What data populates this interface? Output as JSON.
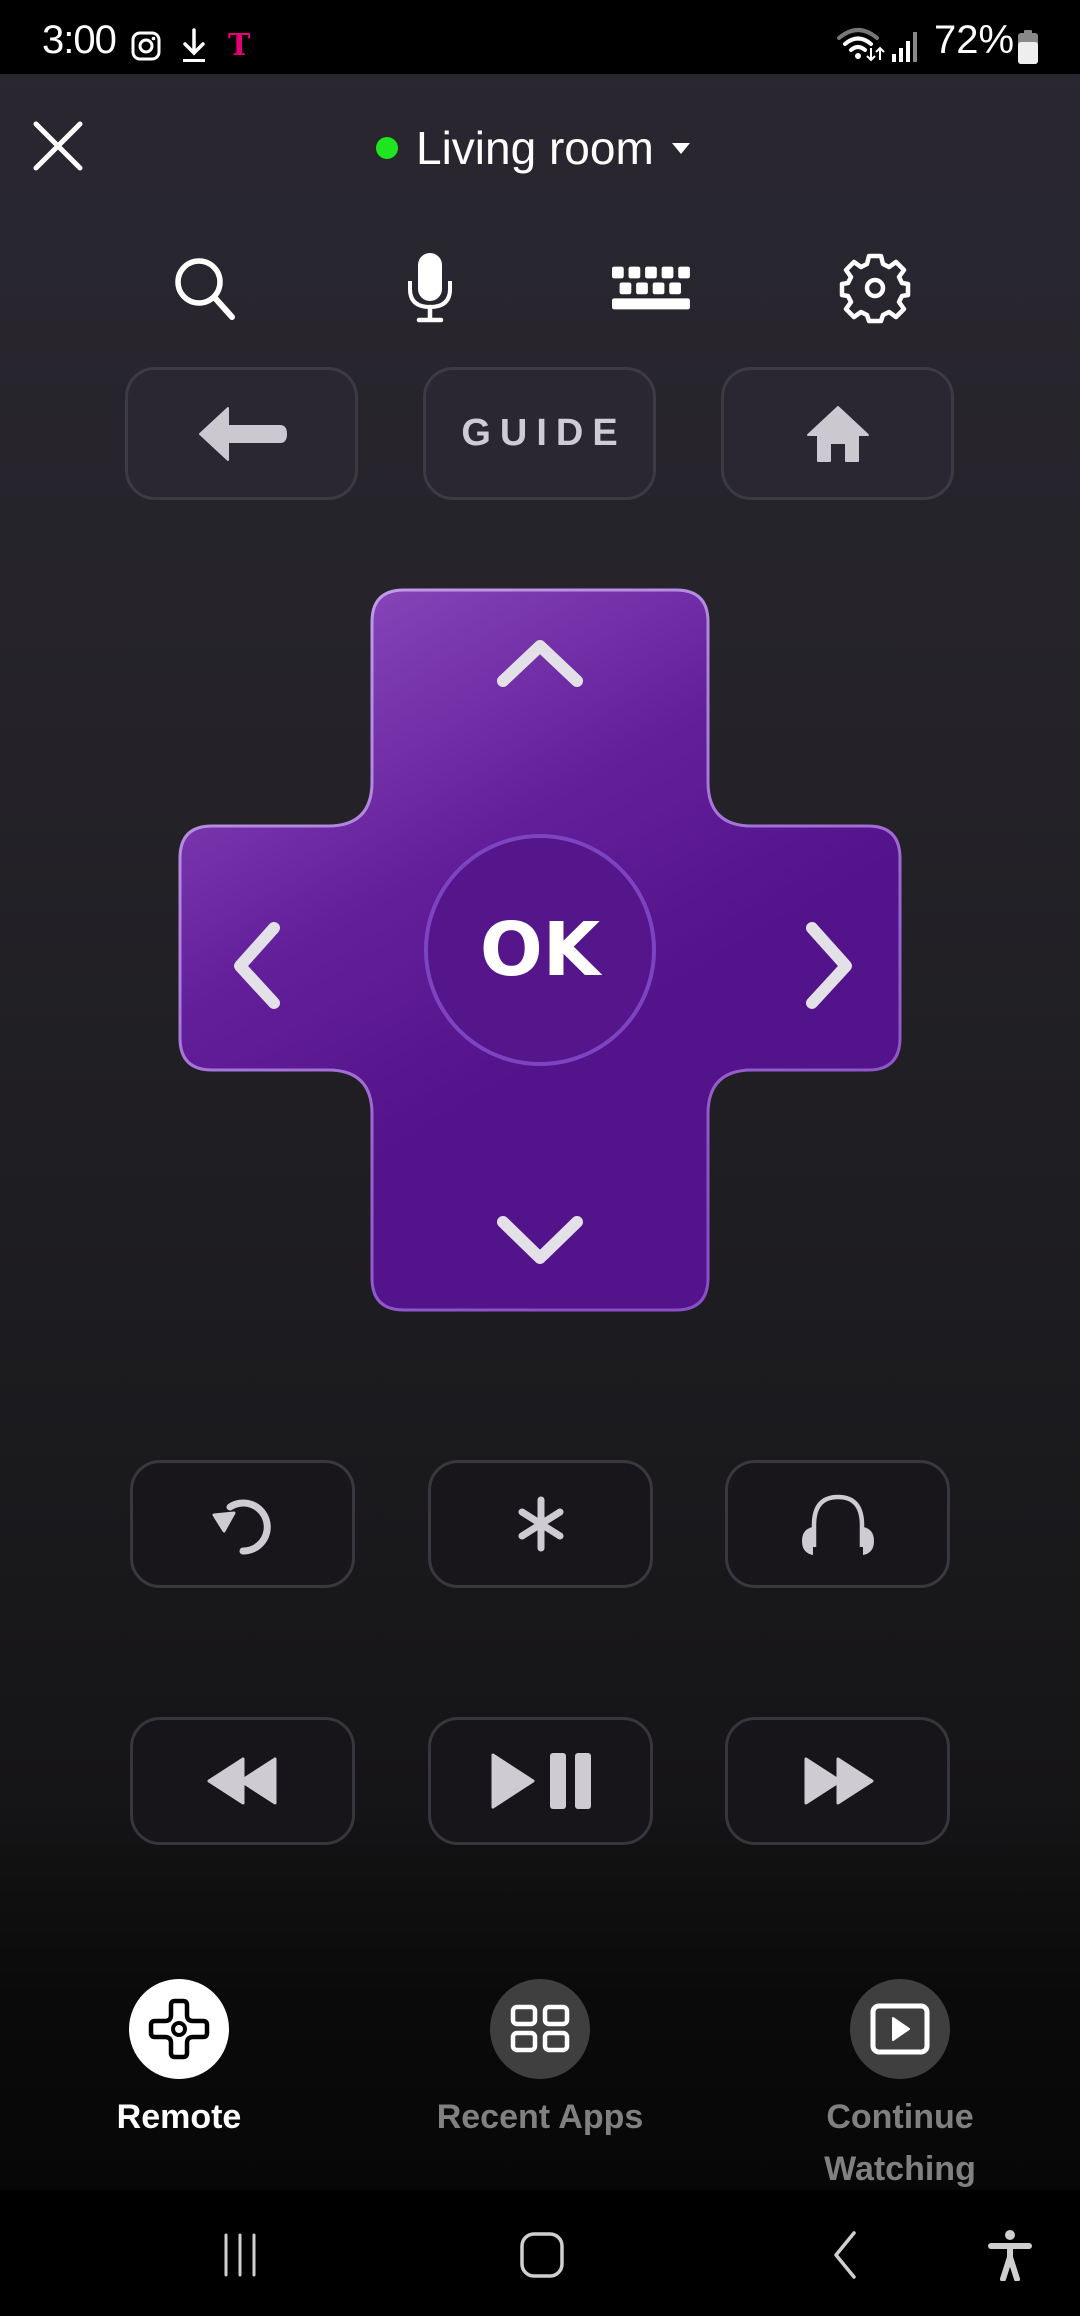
{
  "status_bar": {
    "time": "3:00",
    "battery_percent": "72%",
    "carrier_glyph": "T",
    "carrier_color": "#e20074",
    "icons": [
      "instagram-icon",
      "download-icon",
      "tmobile-icon",
      "wifi-icon",
      "signal-icon",
      "battery-icon"
    ]
  },
  "header": {
    "close_icon": "close-icon",
    "device_name": "Living room",
    "device_status_color": "#1fe51f",
    "device_caret_icon": "caret-down-icon"
  },
  "toolbar": {
    "items": [
      {
        "name": "search",
        "icon": "search-icon"
      },
      {
        "name": "voice",
        "icon": "microphone-icon"
      },
      {
        "name": "keyboard",
        "icon": "keyboard-icon"
      },
      {
        "name": "settings",
        "icon": "gear-icon"
      }
    ]
  },
  "nav_buttons": {
    "back_icon": "arrow-left-icon",
    "guide_label": "GUIDE",
    "home_icon": "home-icon"
  },
  "dpad": {
    "ok_label": "OK",
    "fill_top_color": "#8544b8",
    "fill_color": "#53138a",
    "border_color": "#b68de0"
  },
  "function_buttons": [
    {
      "name": "instant-replay",
      "icon": "replay-icon"
    },
    {
      "name": "options",
      "icon": "asterisk-icon"
    },
    {
      "name": "private-listening",
      "icon": "headphones-icon"
    }
  ],
  "media_buttons": [
    {
      "name": "rewind",
      "icon": "rewind-icon"
    },
    {
      "name": "play-pause",
      "icon": "play-pause-icon"
    },
    {
      "name": "fast-forward",
      "icon": "fast-forward-icon"
    }
  ],
  "bottom_nav": {
    "items": [
      {
        "label": "Remote",
        "icon": "remote-dpad-icon",
        "active": true
      },
      {
        "label": "Recent Apps",
        "icon": "grid-icon",
        "active": false
      },
      {
        "label_line1": "Continue",
        "label_line2": "Watching",
        "icon": "play-window-icon",
        "active": false
      }
    ],
    "active_color": "#ffffff",
    "inactive_color": "#808080"
  },
  "system_nav": {
    "items": [
      "recents-icon",
      "home-icon",
      "back-icon",
      "accessibility-icon"
    ]
  }
}
